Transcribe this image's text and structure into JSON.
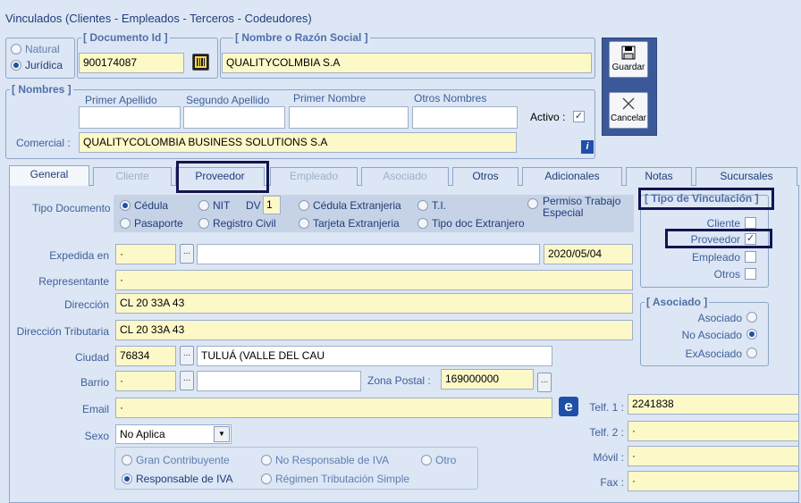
{
  "window": {
    "title": "Vinculados   (Clientes - Empleados - Terceros - Codeudores)"
  },
  "persona": {
    "natural": "Natural",
    "juridica": "Jurídica"
  },
  "documento": {
    "label": "[ Documento Id ]",
    "value": "900174087"
  },
  "nombre_razon": {
    "label": "[ Nombre o Razón Social ]",
    "value": "QUALITYCOLMBIA S.A"
  },
  "nombres": {
    "label": "[ Nombres ]",
    "primer_apellido": "Primer Apellido",
    "segundo_apellido": "Segundo Apellido",
    "primer_nombre": "Primer Nombre",
    "otros_nombres": "Otros Nombres",
    "activo_label": "Activo :",
    "activo_check": "✓"
  },
  "comercial": {
    "label": "Comercial :",
    "value": "QUALITYCOLOMBIA BUSINESS SOLUTIONS S.A"
  },
  "buttons": {
    "guardar": "Guardar",
    "cancelar": "Cancelar",
    "info": "i"
  },
  "tabs": [
    "General",
    "Cliente",
    "Proveedor",
    "Empleado",
    "Asociado",
    "Otros",
    "Adicionales",
    "Notas",
    "Sucursales"
  ],
  "tipo_documento": {
    "label": "Tipo Documento",
    "cedula": "Cédula",
    "nit": "NIT",
    "dv_label": "DV",
    "dv_value": "1",
    "cedula_ext": "Cédula Extranjeria",
    "ti": "T.I.",
    "permiso1": "Permiso Trabajo",
    "permiso2": "Especial",
    "pasaporte": "Pasaporte",
    "registro": "Registro Civil",
    "tarjeta": "Tarjeta Extranjeria",
    "tipo_ext": "Tipo doc Extranjero"
  },
  "fields": {
    "expedida_label": "Expedida en",
    "expedida_value": "·",
    "fecha": "2020/05/04",
    "representante_label": "Representante",
    "representante_value": "·",
    "direccion_label": "Dirección",
    "direccion_value": "CL 20 33A 43",
    "dir_trib_label": "Dirección Tributaria",
    "dir_trib_value": "CL 20 33A 43",
    "ciudad_label": "Ciudad",
    "ciudad_code": "76834",
    "ciudad_name": "TULUÁ (VALLE DEL CAU",
    "barrio_label": "Barrio",
    "barrio_value": "·",
    "zona_label": "Zona Postal :",
    "zona_value": "169000000",
    "email_label": "Email",
    "email_value": "·",
    "sexo_label": "Sexo",
    "sexo_value": "No Aplica",
    "telf1_label": "Telf. 1 :",
    "telf1_value": "2241838",
    "telf2_label": "Telf. 2 :",
    "telf2_value": "·",
    "movil_label": "Móvil :",
    "movil_value": "·",
    "fax_label": "Fax :",
    "fax_value": "·",
    "email_icon": "e"
  },
  "iva": {
    "gran": "Gran Contribuyente",
    "no_resp": "No Responsable de IVA",
    "otro": "Otro",
    "resp": "Responsable de IVA",
    "simple": "Régimen Tributación Simple"
  },
  "vinculacion": {
    "label": "[ Tipo de Vinculación ]",
    "cliente": "Cliente",
    "proveedor": "Proveedor",
    "empleado": "Empleado",
    "otros": "Otros",
    "check": "✓"
  },
  "asociado": {
    "label": "[ Asociado ]",
    "asociado": "Asociado",
    "no_asociado": "No Asociado",
    "exasociado": "ExAsociado"
  },
  "colors": {
    "background": "#dce6f4",
    "input": "#fdf8c8",
    "highlight": "#141450",
    "text": "#1f3d7a"
  }
}
